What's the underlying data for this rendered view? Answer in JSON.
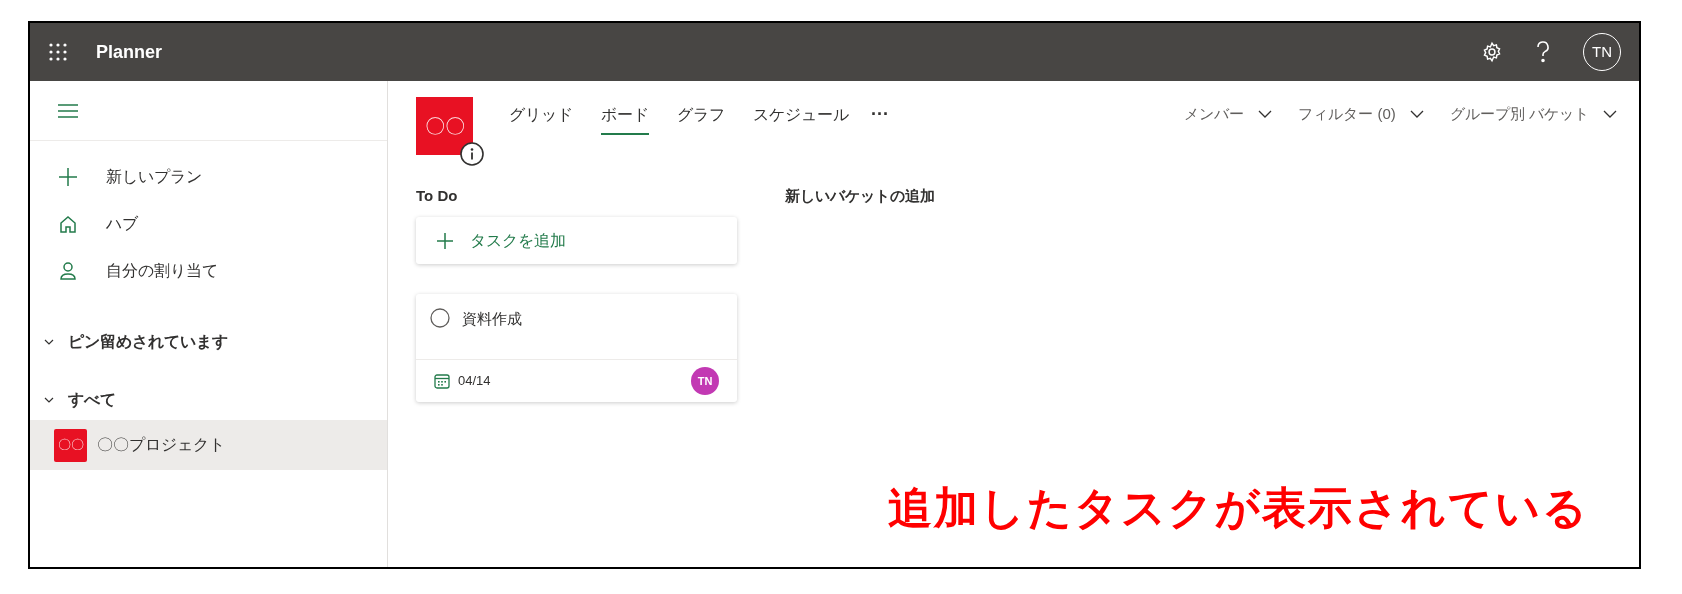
{
  "app": {
    "title": "Planner",
    "avatar": "TN"
  },
  "sidebar": {
    "items": [
      {
        "kind": "new",
        "label": "新しいプラン"
      },
      {
        "kind": "hub",
        "label": "ハブ"
      },
      {
        "kind": "assigned",
        "label": "自分の割り当て"
      }
    ],
    "sections": [
      {
        "label": "ピン留めされています",
        "expanded": true
      },
      {
        "label": "すべて",
        "expanded": true,
        "plans": [
          {
            "label": "〇〇プロジェクト",
            "logo": "〇〇",
            "selected": true
          }
        ]
      }
    ]
  },
  "plan": {
    "logo": "〇〇",
    "tabs": [
      {
        "label": "グリッド",
        "selected": false
      },
      {
        "label": "ボード",
        "selected": true
      },
      {
        "label": "グラフ",
        "selected": false
      },
      {
        "label": "スケジュール",
        "selected": false
      }
    ],
    "more": "···",
    "filters": [
      {
        "label": "メンバー"
      },
      {
        "label": "フィルター (0)"
      },
      {
        "label": "グループ別 バケット"
      }
    ]
  },
  "buckets": [
    {
      "name": "To Do",
      "add_label": "タスクを追加",
      "tasks": [
        {
          "title": "資料作成",
          "completed": false,
          "due": "04/14",
          "assignee": "TN",
          "color": "#c239b3"
        }
      ]
    }
  ],
  "new_bucket": "新しいバケットの追加",
  "annotation": "追加したタスクが表示されている"
}
